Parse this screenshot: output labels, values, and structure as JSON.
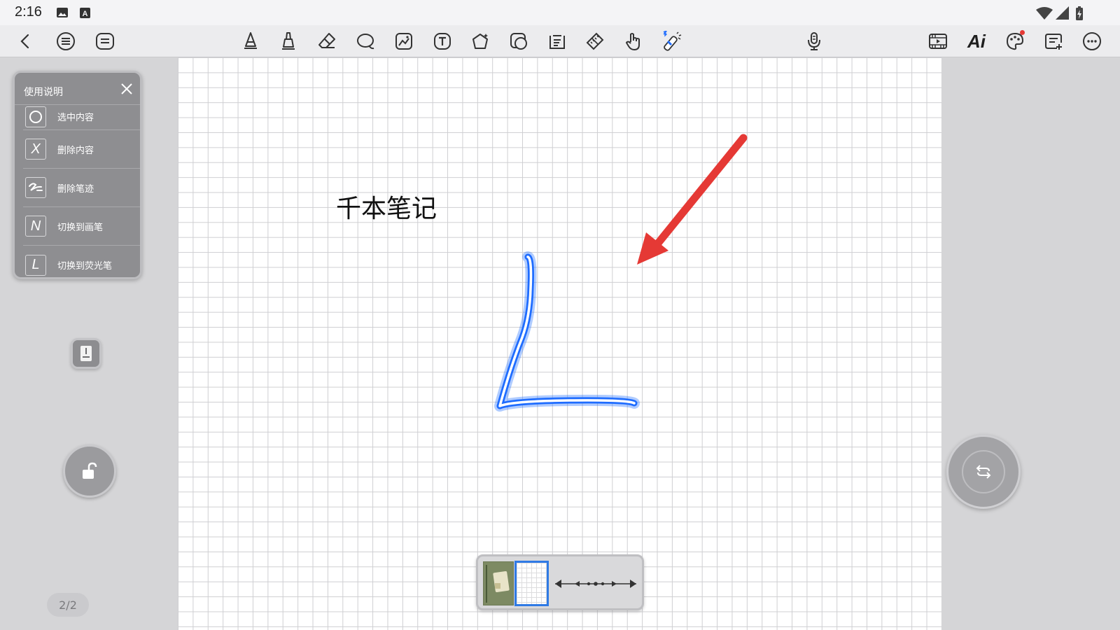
{
  "status_bar": {
    "time": "2:16",
    "icons": [
      "image-icon",
      "a-icon",
      "wifi-icon",
      "signal-icon",
      "battery-icon"
    ]
  },
  "toolbar": {
    "left_icons": [
      "back-icon",
      "list-icon",
      "menu-icon"
    ],
    "center_icons": [
      "pen-icon",
      "brush-icon",
      "eraser-icon",
      "lasso-icon",
      "image-icon",
      "text-icon",
      "shape-icon",
      "sticker-icon",
      "textbox-icon",
      "ruler-icon",
      "hand-icon",
      "bluetooth-pen-icon"
    ],
    "mic_icon": "microphone-icon",
    "ai_label": "Ai",
    "right_icons": [
      "video-icon",
      "palette-icon",
      "note-add-icon",
      "more-icon"
    ]
  },
  "help_panel": {
    "title": "使用说明",
    "items": [
      {
        "icon_text": "",
        "icon": "circle-icon",
        "label": "选中内容"
      },
      {
        "icon_text": "X",
        "icon": "x-icon",
        "label": "删除内容"
      },
      {
        "icon_text": "",
        "icon": "scribble-icon",
        "label": "删除笔迹"
      },
      {
        "icon_text": "N",
        "icon": "n-icon",
        "label": "切换到画笔"
      },
      {
        "icon_text": "L",
        "icon": "l-icon",
        "label": "切换到荧光笔"
      }
    ]
  },
  "canvas": {
    "note_title": "千本笔记",
    "colors": {
      "highlighter": "#1e6cff",
      "arrow": "#e53935",
      "grid": "#cfcfd2"
    }
  },
  "page_indicator": "2/2",
  "accent_color": "#2f7ae5"
}
